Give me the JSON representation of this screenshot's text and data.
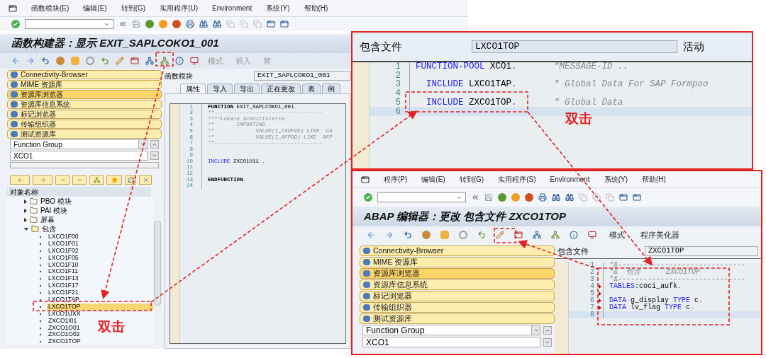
{
  "main_window": {
    "menu": [
      "函数模块(E)",
      "编辑(E)",
      "转到(G)",
      "实用程序(U)",
      "Environment",
      "系统(Y)",
      "帮助(H)"
    ],
    "title": "函数构建器：显示 EXIT_SAPLCOKO1_001",
    "app_toolbar_labels": [
      {
        "text": "模式",
        "disabled": true
      },
      {
        "text": "插入",
        "disabled": true
      },
      {
        "text": "替",
        "disabled": true
      }
    ],
    "nav_items": [
      {
        "label": "Connectivity-Browser",
        "selected": false
      },
      {
        "label": "MIME 资源库",
        "selected": false
      },
      {
        "label": "资源库浏览器",
        "selected": true
      },
      {
        "label": "资源库信息系统",
        "selected": false
      },
      {
        "label": "标记浏览器",
        "selected": false
      },
      {
        "label": "传输组织器",
        "selected": false
      },
      {
        "label": "测试资源库",
        "selected": false
      }
    ],
    "object_type": "Function Group",
    "object_name": "XCO1",
    "tree_header": "对象名称",
    "tree": [
      {
        "label": "PBO 模块",
        "expanded": false
      },
      {
        "label": "PAI 模块",
        "expanded": false
      },
      {
        "label": "屏幕",
        "expanded": false
      },
      {
        "label": "包含",
        "expanded": true,
        "children": [
          {
            "label": "LXCO1F00",
            "selected": false
          },
          {
            "label": "LXCO1F01",
            "selected": false
          },
          {
            "label": "LXCO1F02",
            "selected": false
          },
          {
            "label": "LXCO1F05",
            "selected": false
          },
          {
            "label": "LXCO1F10",
            "selected": false
          },
          {
            "label": "LXCO1F11",
            "selected": false
          },
          {
            "label": "LXCO1F13",
            "selected": false
          },
          {
            "label": "LXCO1F17",
            "selected": false
          },
          {
            "label": "LXCO1F21",
            "selected": false
          },
          {
            "label": "LXCO1TAP",
            "selected": false
          },
          {
            "label": "LXCO1TOP",
            "selected": true
          },
          {
            "label": "LXCO1UXX",
            "selected": false
          },
          {
            "label": "ZXCO1I01",
            "selected": false
          },
          {
            "label": "ZXCO1O01",
            "selected": false
          },
          {
            "label": "ZXCO1O02",
            "selected": false
          },
          {
            "label": "ZXCO1TOP",
            "selected": false
          }
        ]
      }
    ],
    "field_label": "函数模块",
    "field_value": "EXIT_SAPLCOKO1_001",
    "tabs": [
      {
        "label": "属性",
        "selected": true
      },
      {
        "label": "导入",
        "selected": false
      },
      {
        "label": "导出",
        "selected": false
      },
      {
        "label": "正在更改",
        "selected": false
      },
      {
        "label": "表",
        "selected": false
      },
      {
        "label": "例",
        "selected": false
      }
    ],
    "lines": [
      {
        "number": "1",
        "tokens": [
          {
            "text": "FUNCTION",
            "kind": "bold"
          },
          {
            "text": " EXIT_SAPLCOKO1_001",
            "kind": "plain"
          },
          {
            "text": ".",
            "kind": "punct"
          }
        ]
      },
      {
        "number": "2",
        "tokens": [
          {
            "text": "*\"----------------------------------",
            "kind": "comment"
          }
        ]
      },
      {
        "number": "3",
        "tokens": [
          {
            "text": "*\"*\"Lokale Schnittstelle:",
            "kind": "comment"
          }
        ]
      },
      {
        "number": "4",
        "tokens": [
          {
            "text": "*\"       IMPORTING",
            "kind": "comment"
          }
        ]
      },
      {
        "number": "5",
        "tokens": [
          {
            "text": "*\"             VALUE(I_CAUFVD) LIKE  CA",
            "kind": "comment"
          }
        ]
      },
      {
        "number": "6",
        "tokens": [
          {
            "text": "*\"             VALUE(I_AFPOD) LIKE  AFP",
            "kind": "comment"
          }
        ]
      },
      {
        "number": "7",
        "tokens": [
          {
            "text": "*\"----------------------------------",
            "kind": "comment"
          }
        ]
      },
      {
        "number": "8"
      },
      {
        "number": "9"
      },
      {
        "number": "10",
        "tokens": [
          {
            "text": "INCLUDE",
            "kind": "keyword"
          },
          {
            "text": " ZXCO1U11 ",
            "kind": "plain"
          },
          {
            "text": ".",
            "kind": "punct"
          }
        ]
      },
      {
        "number": "11"
      },
      {
        "number": "12"
      },
      {
        "number": "13",
        "tokens": [
          {
            "text": "ENDFUNCTION",
            "kind": "bold"
          },
          {
            "text": ".",
            "kind": "punct"
          }
        ]
      },
      {
        "number": "14"
      }
    ]
  },
  "include_popup": {
    "field_label": "包含文件",
    "field_value": "LXCO1TOP",
    "status": "活动",
    "annotation": "双击",
    "lines": [
      {
        "number": "1",
        "current": false,
        "tokens": [
          {
            "text": "FUNCTION-POOL",
            "kind": "keyword"
          },
          {
            "text": " XCO1",
            "kind": "plain"
          },
          {
            "text": ".",
            "kind": "punct"
          },
          {
            "text": "       \"MESSAGE-ID ..",
            "kind": "comment"
          }
        ]
      },
      {
        "number": "2",
        "current": false
      },
      {
        "number": "3",
        "current": false,
        "tokens": [
          {
            "text": "  INCLUDE",
            "kind": "keyword"
          },
          {
            "text": " LXCO1TAP",
            "kind": "plain"
          },
          {
            "text": ".",
            "kind": "punct"
          },
          {
            "text": "       \" Global Data For SAP Formpoo",
            "kind": "comment"
          }
        ]
      },
      {
        "number": "4",
        "current": false
      },
      {
        "number": "5",
        "current": false,
        "tokens": [
          {
            "text": "  INCLUDE",
            "kind": "keyword"
          },
          {
            "text": " ZXCO1TOP",
            "kind": "plain"
          },
          {
            "text": ".",
            "kind": "punct"
          },
          {
            "text": "       \" Global Data",
            "kind": "comment"
          }
        ]
      },
      {
        "number": "6",
        "current": true
      }
    ]
  },
  "editor_window": {
    "menu": [
      "程序(P)",
      "编辑(E)",
      "转到(G)",
      "实用程序(S)",
      "Environment",
      "系统(Y)",
      "帮助(H)"
    ],
    "title": "ABAP 编辑器：更改 包含文件 ZXCO1TOP",
    "app_toolbar_labels": [
      {
        "text": "模式",
        "disabled": false
      },
      {
        "text": "程序美化器",
        "disabled": false
      }
    ],
    "nav_items": [
      {
        "label": "Connectivity-Browser",
        "selected": false
      },
      {
        "label": "MIME 资源库",
        "selected": false
      },
      {
        "label": "资源库浏览器",
        "selected": true
      },
      {
        "label": "资源库信息系统",
        "selected": false
      },
      {
        "label": "标记浏览器",
        "selected": false
      },
      {
        "label": "传输组织器",
        "selected": false
      },
      {
        "label": "测试资源库",
        "selected": false
      }
    ],
    "object_type": "Function Group",
    "object_name": "XCO1",
    "field_label": "包含文件",
    "field_value": "ZXCO1TOP",
    "lines": [
      {
        "number": "1",
        "current": false,
        "changed": false,
        "tokens": [
          {
            "text": "*&------------------------------",
            "kind": "comment"
          }
        ]
      },
      {
        "number": "2",
        "current": false,
        "changed": false,
        "tokens": [
          {
            "text": "*&  包含      ZXCO1TOP",
            "kind": "comment"
          }
        ]
      },
      {
        "number": "3",
        "current": false,
        "changed": false,
        "tokens": [
          {
            "text": "*&------------------------------",
            "kind": "comment"
          }
        ]
      },
      {
        "number": "4",
        "current": false,
        "changed": true,
        "tokens": [
          {
            "text": "TABLES",
            "kind": "keyword"
          },
          {
            "text": ":coci_aufk",
            "kind": "plain"
          },
          {
            "text": ".",
            "kind": "punct"
          }
        ]
      },
      {
        "number": "5",
        "current": false,
        "changed": true
      },
      {
        "number": "6",
        "current": false,
        "changed": true,
        "tokens": [
          {
            "text": "DATA",
            "kind": "keyword"
          },
          {
            "text": " g_display ",
            "kind": "plain"
          },
          {
            "text": "TYPE",
            "kind": "keyword"
          },
          {
            "text": " c",
            "kind": "plain"
          },
          {
            "text": ".",
            "kind": "punct"
          }
        ]
      },
      {
        "number": "7",
        "current": false,
        "changed": true,
        "tokens": [
          {
            "text": "DATA",
            "kind": "keyword"
          },
          {
            "text": " lv_flag ",
            "kind": "plain"
          },
          {
            "text": "TYPE",
            "kind": "keyword"
          },
          {
            "text": " c",
            "kind": "plain"
          },
          {
            "text": ".",
            "kind": "punct"
          }
        ]
      },
      {
        "number": "8",
        "current": true,
        "changed": false
      }
    ]
  },
  "annotation": "双击"
}
